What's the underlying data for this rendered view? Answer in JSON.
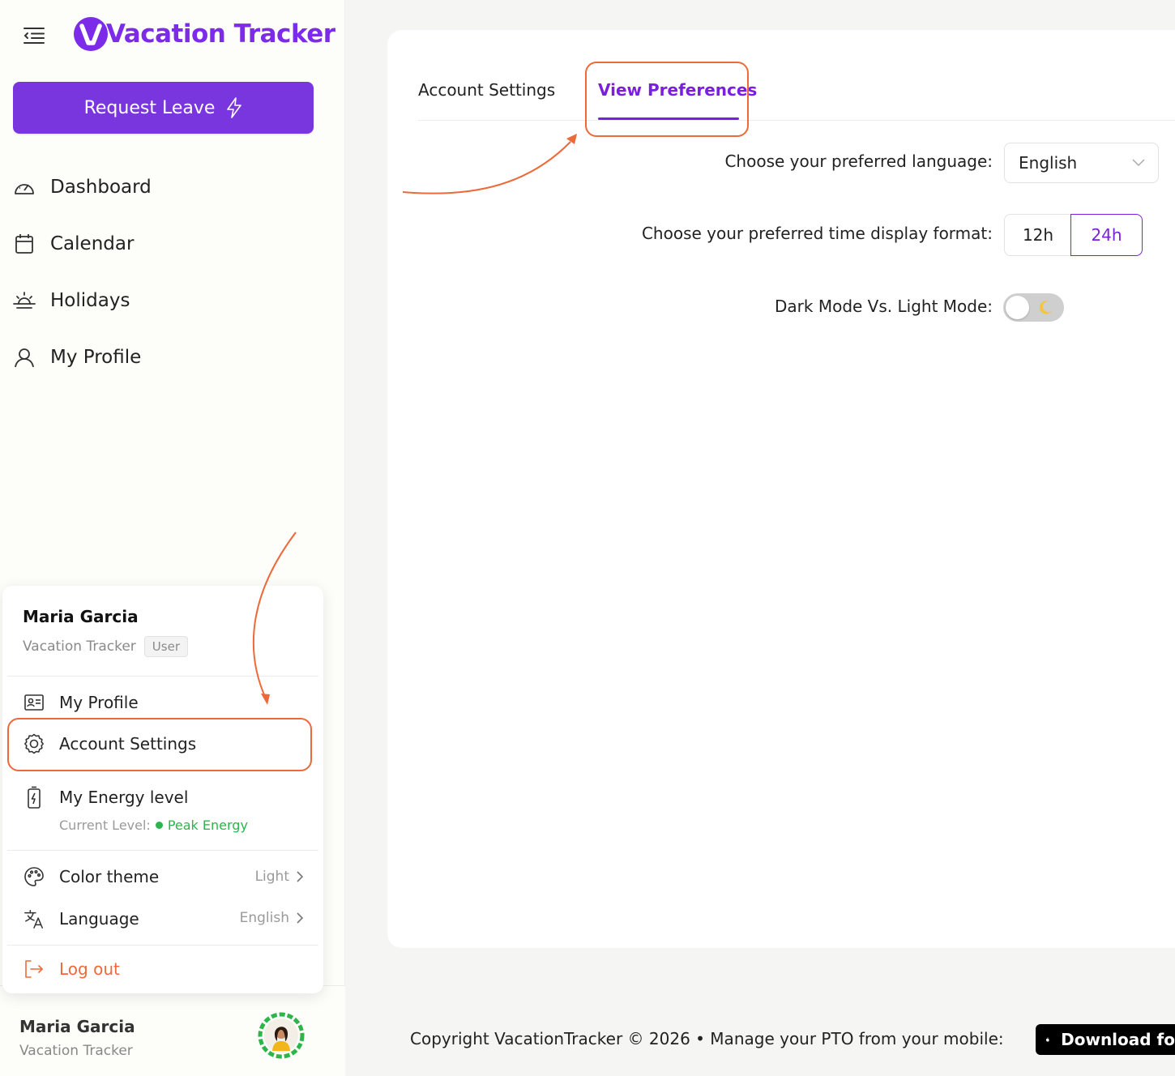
{
  "app": {
    "title": "Vacation Tracker",
    "brand_color": "#7c2ce8",
    "annotation_color": "#ec6a3a"
  },
  "sidebar": {
    "request_button": "Request Leave",
    "nav": [
      {
        "label": "Dashboard",
        "icon": "dashboard-gauge-icon"
      },
      {
        "label": "Calendar",
        "icon": "calendar-icon"
      },
      {
        "label": "Holidays",
        "icon": "sunrise-icon"
      },
      {
        "label": "My Profile",
        "icon": "user-icon"
      }
    ]
  },
  "user_menu": {
    "name": "Maria Garcia",
    "organization": "Vacation Tracker",
    "role": "User",
    "items": {
      "my_profile": "My Profile",
      "account_settings": "Account Settings",
      "energy_level": "My Energy level",
      "energy_current_label": "Current Level:",
      "energy_current_value": "Peak Energy",
      "color_theme": "Color theme",
      "color_theme_value": "Light",
      "language": "Language",
      "language_value": "English",
      "logout": "Log out"
    }
  },
  "footer_user": {
    "name": "Maria Garcia",
    "organization": "Vacation Tracker"
  },
  "settings": {
    "tabs": [
      {
        "label": "Account Settings",
        "active": false
      },
      {
        "label": "View Preferences",
        "active": true
      }
    ],
    "language_label": "Choose your preferred language:",
    "language_value": "English",
    "time_format_label": "Choose your preferred time display format:",
    "time_format_options": [
      "12h",
      "24h"
    ],
    "time_format_selected": "24h",
    "dark_mode_label": "Dark Mode Vs. Light Mode:",
    "dark_mode_enabled": false
  },
  "footer": {
    "copyright": "Copyright VacationTracker © 2026 •  Manage your PTO from your mobile:",
    "download_label": "Download fo"
  }
}
